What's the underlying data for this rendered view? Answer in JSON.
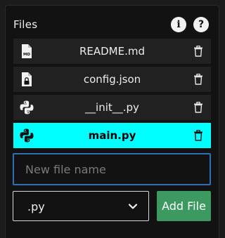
{
  "header": {
    "title": "Files",
    "info_icon": "info-icon",
    "help_icon": "help-icon"
  },
  "files": [
    {
      "name": "README.md",
      "icon": "markdown-file-icon",
      "active": false
    },
    {
      "name": "config.json",
      "icon": "locked-file-icon",
      "active": false
    },
    {
      "name": "__init__.py",
      "icon": "python-icon",
      "active": false
    },
    {
      "name": "main.py",
      "icon": "python-icon",
      "active": true
    }
  ],
  "new_file": {
    "placeholder": "New file name",
    "value": ""
  },
  "extension_select": {
    "selected": ".py"
  },
  "add_button": {
    "label": "Add File"
  },
  "colors": {
    "active_row": "#00ffff",
    "add_button": "#3c9a61",
    "input_border": "#2f6fb5",
    "panel": "#121212",
    "row": "#212121"
  }
}
